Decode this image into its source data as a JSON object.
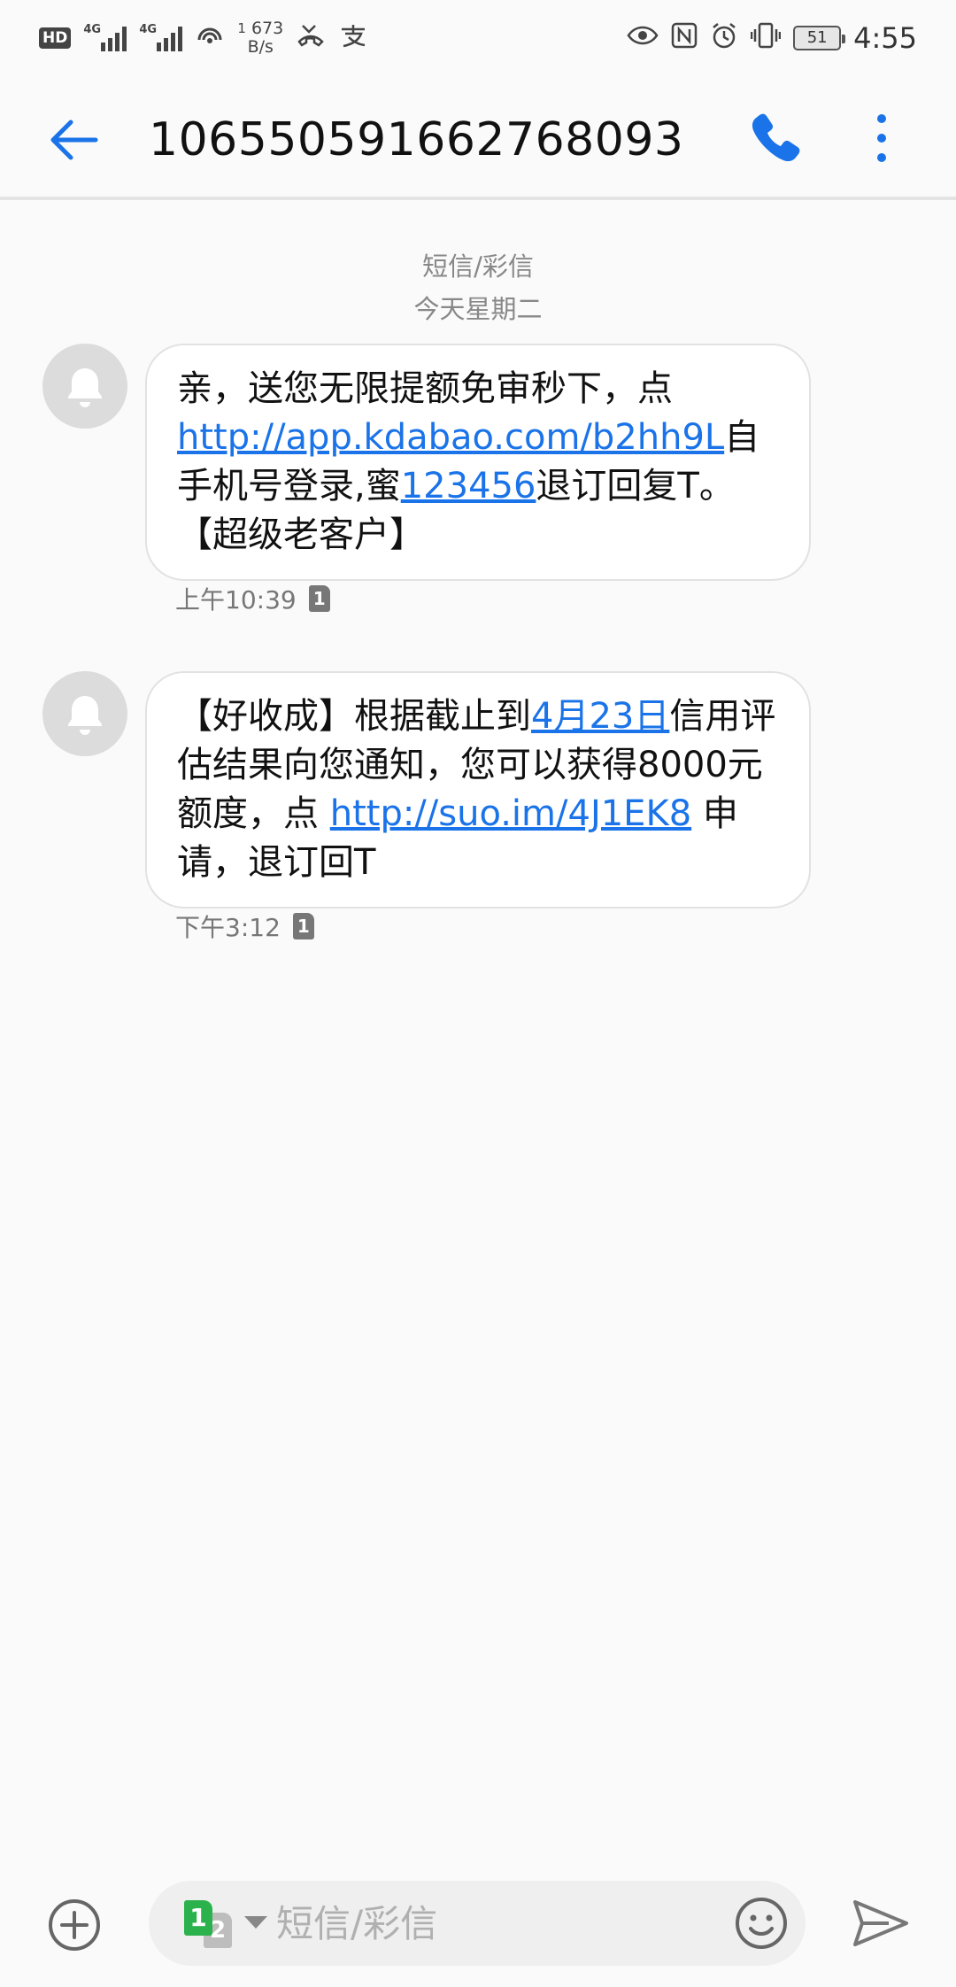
{
  "status_bar": {
    "hd": "HD",
    "sig1_label": "4G",
    "sig2_label": "4G",
    "speed_sup": "1",
    "speed_value": "673",
    "speed_unit": "B/s",
    "battery": "51",
    "time": "4:55"
  },
  "header": {
    "title": "10655059166276809​3"
  },
  "thread": {
    "type_label": "短信/彩信",
    "date_label": "今天星期二"
  },
  "messages": [
    {
      "parts": [
        {
          "text": "亲，送您无限提额免审秒下，点 "
        },
        {
          "link": "http://app.kdabao.com/b2hh9L"
        },
        {
          "text": "自手机号登录,蜜"
        },
        {
          "link": "123456"
        },
        {
          "text": "退订回复T。【超级老客户】"
        }
      ],
      "time": "上午10:39",
      "sim": "1"
    },
    {
      "parts": [
        {
          "text": "【好收成】根据截止到"
        },
        {
          "link": "4月23日"
        },
        {
          "text": "信用评估结果向您通知，您可以获得8000元额度，点 "
        },
        {
          "link": "http://suo.im/4J1EK8"
        },
        {
          "text": " 申请，退订回T"
        }
      ],
      "time": "下午3:12",
      "sim": "1"
    }
  ],
  "input_bar": {
    "sim_primary": "1",
    "sim_secondary": "2",
    "placeholder": "短信/彩信"
  },
  "colors": {
    "accent": "#1a73e8",
    "background": "#fafafa",
    "bubble": "#ffffff",
    "avatar": "#dcdcdc",
    "sim_green": "#2bb24c"
  },
  "icons": {
    "back": "arrow-left-icon",
    "call": "phone-icon",
    "more": "more-vertical-icon",
    "avatar": "bell-icon",
    "attach": "add-circle-icon",
    "emoji": "smiley-icon",
    "send": "send-icon"
  }
}
